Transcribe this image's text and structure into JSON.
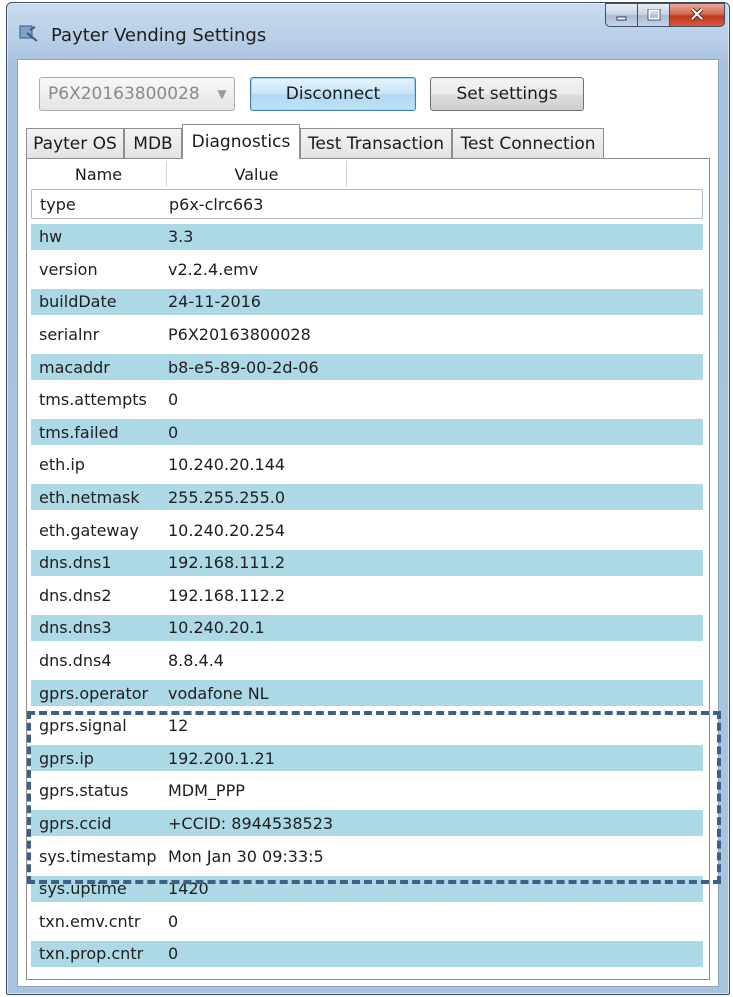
{
  "window": {
    "title": "Payter Vending Settings"
  },
  "toolbar": {
    "device_combo_value": "P6X20163800028",
    "disconnect_label": "Disconnect",
    "set_settings_label": "Set settings"
  },
  "tabs": [
    "Payter OS",
    "MDB",
    "Diagnostics",
    "Test Transaction",
    "Test Connection"
  ],
  "selected_tab": "Diagnostics",
  "grid": {
    "columns": [
      "Name",
      "Value"
    ],
    "rows": [
      {
        "name": "type",
        "value": "p6x-clrc663"
      },
      {
        "name": "hw",
        "value": "3.3"
      },
      {
        "name": "version",
        "value": "v2.2.4.emv"
      },
      {
        "name": "buildDate",
        "value": "24-11-2016"
      },
      {
        "name": "serialnr",
        "value": "P6X20163800028"
      },
      {
        "name": "macaddr",
        "value": "b8-e5-89-00-2d-06"
      },
      {
        "name": "tms.attempts",
        "value": "0"
      },
      {
        "name": "tms.failed",
        "value": "0"
      },
      {
        "name": "eth.ip",
        "value": "10.240.20.144"
      },
      {
        "name": "eth.netmask",
        "value": "255.255.255.0"
      },
      {
        "name": "eth.gateway",
        "value": "10.240.20.254"
      },
      {
        "name": "dns.dns1",
        "value": "192.168.111.2"
      },
      {
        "name": "dns.dns2",
        "value": "192.168.112.2"
      },
      {
        "name": "dns.dns3",
        "value": "10.240.20.1"
      },
      {
        "name": "dns.dns4",
        "value": "8.8.4.4"
      },
      {
        "name": "gprs.operator",
        "value": "vodafone NL"
      },
      {
        "name": "gprs.signal",
        "value": "12"
      },
      {
        "name": "gprs.ip",
        "value": "192.200.1.21"
      },
      {
        "name": "gprs.status",
        "value": "MDM_PPP"
      },
      {
        "name": "gprs.ccid",
        "value": "+CCID: 8944538523"
      },
      {
        "name": "sys.timestamp",
        "value": "Mon Jan 30 09:33:5"
      },
      {
        "name": "sys.uptime",
        "value": "1420"
      },
      {
        "name": "txn.emv.cntr",
        "value": "0"
      },
      {
        "name": "txn.prop.cntr",
        "value": "0"
      }
    ]
  },
  "colors": {
    "alt_row": "#add8e6",
    "highlight_dash": "#3f5f86"
  }
}
